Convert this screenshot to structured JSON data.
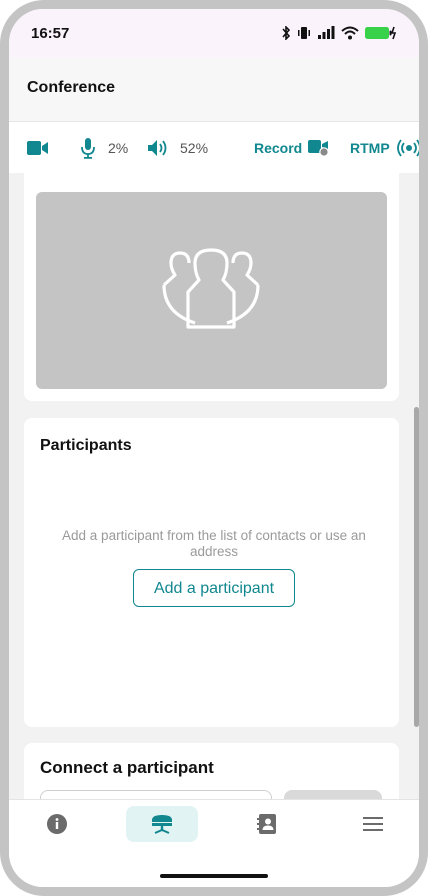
{
  "status_bar": {
    "time": "16:57"
  },
  "app_bar": {
    "title": "Conference"
  },
  "toolbar": {
    "mic_level": "2%",
    "speaker_level": "52%",
    "record_label": "Record",
    "rtmp_label": "RTMP"
  },
  "participants_card": {
    "title": "Participants",
    "empty_message": "Add a participant from the list of contacts or use an address",
    "add_button_label": "Add a participant"
  },
  "connect_card": {
    "title": "Connect a participant"
  },
  "bottom_nav": {
    "items": [
      {
        "icon": "info-icon",
        "active": false
      },
      {
        "icon": "conference-icon",
        "active": true
      },
      {
        "icon": "contacts-icon",
        "active": false
      },
      {
        "icon": "menu-icon",
        "active": false
      }
    ]
  },
  "colors": {
    "accent": "#11878f",
    "placeholder_gray": "#c4c4c4",
    "active_tab_bg": "#e2f3f4"
  }
}
